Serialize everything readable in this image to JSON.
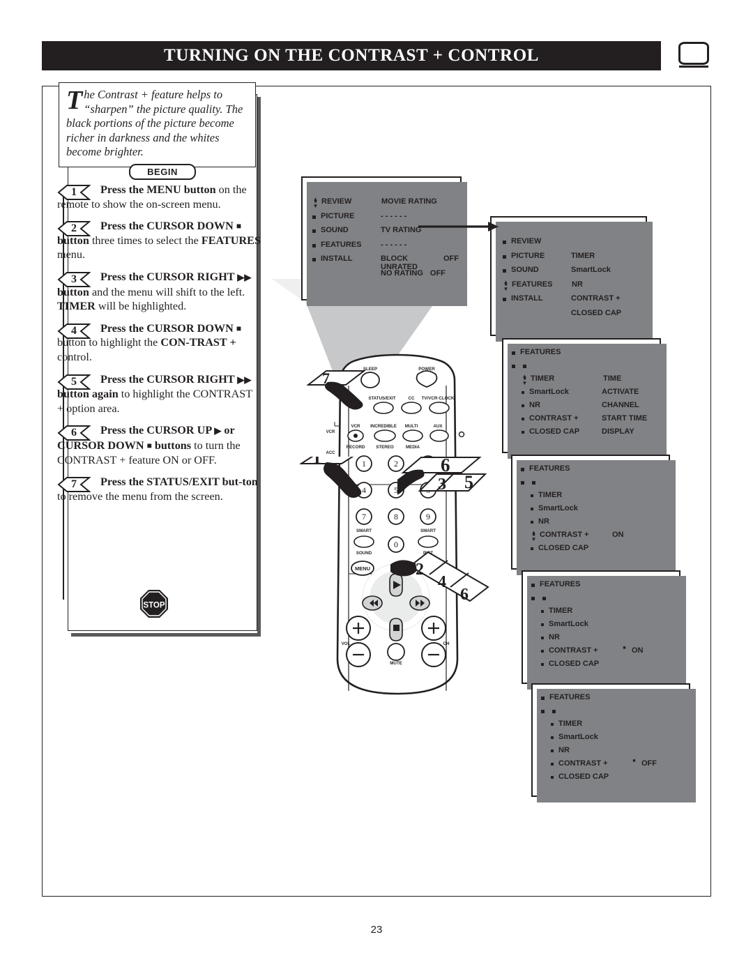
{
  "header": {
    "title": "TURNING ON THE CONTRAST + CONTROL",
    "tv_icon": "tv-screen-icon"
  },
  "intro": {
    "dropcap": "T",
    "text": "he Contrast + feature helps to “sharpen” the picture quality. The black portions of the picture become richer in darkness and the whites become brighter."
  },
  "begin_label": "BEGIN",
  "stop_label": "STOP",
  "steps": [
    {
      "num": "1",
      "html": "<b>Press the MENU button</b> on the remote to show the on-screen menu."
    },
    {
      "num": "2",
      "html": "<b>Press the CURSOR DOWN <span class=\"sq\">■</span> button</b> three times to select the <b>FEATURES</b> menu."
    },
    {
      "num": "3",
      "html": "<b>Press the CURSOR RIGHT <span class=\"tri\">▶▶</span> button</b> and the menu will shift to the left. <b>TIMER</b> will be highlighted."
    },
    {
      "num": "4",
      "html": "<b>Press the CURSOR DOWN <span class=\"sq\">■</span></b> button to highlight the <b>CON-TRAST +</b> control."
    },
    {
      "num": "5",
      "html": "<b>Press the CURSOR RIGHT <span class=\"tri\">▶▶</span> button again</b> to highlight the CONTRAST + option area."
    },
    {
      "num": "6",
      "html": "<b>Press the CURSOR UP <span class=\"tri\">▶</span> or CURSOR DOWN <span class=\"sq\">■</span> buttons</b> to turn the CONTRAST + feature ON or OFF."
    },
    {
      "num": "7",
      "html": "<b>Press the STATUS/EXIT but-ton</b> to remove the menu from the screen."
    }
  ],
  "menus": [
    {
      "id": "menu-main",
      "left_items": [
        "REVIEW",
        "PICTURE",
        "SOUND",
        "FEATURES",
        "INSTALL"
      ],
      "cursor_on": "REVIEW",
      "right_items": [
        {
          "label": "MOVIE RATING",
          "value": ""
        },
        {
          "label": "- - - - - -",
          "value": ""
        },
        {
          "label": "TV RATING",
          "value": ""
        },
        {
          "label": "- - - - - -",
          "value": ""
        },
        {
          "label": "BLOCK UNRATED",
          "value": "OFF"
        },
        {
          "label": "NO RATING",
          "value": "OFF"
        }
      ]
    },
    {
      "id": "menu-features-selected",
      "left_items": [
        "REVIEW",
        "PICTURE",
        "SOUND",
        "FEATURES",
        "INSTALL"
      ],
      "cursor_on": "FEATURES",
      "right_items": [
        {
          "label": "",
          "value": ""
        },
        {
          "label": "TIMER",
          "value": ""
        },
        {
          "label": "SmartLock",
          "value": ""
        },
        {
          "label": "NR",
          "value": ""
        },
        {
          "label": "CONTRAST +",
          "value": ""
        },
        {
          "label": "CLOSED CAP",
          "value": ""
        }
      ]
    },
    {
      "id": "menu-timer-highlighted",
      "title": "FEATURES",
      "left_items": [
        "TIMER",
        "SmartLock",
        "NR",
        "CONTRAST +",
        "CLOSED CAP"
      ],
      "cursor_on": "TIMER",
      "right_items": [
        {
          "label": "TIME",
          "value": ""
        },
        {
          "label": "ACTIVATE",
          "value": ""
        },
        {
          "label": "CHANNEL",
          "value": ""
        },
        {
          "label": "START TIME",
          "value": ""
        },
        {
          "label": "DISPLAY",
          "value": ""
        }
      ]
    },
    {
      "id": "menu-contrast-highlighted",
      "title": "FEATURES",
      "left_items": [
        "TIMER",
        "SmartLock",
        "NR",
        "CONTRAST +",
        "CLOSED CAP"
      ],
      "cursor_on": "CONTRAST +",
      "value_label": "ON",
      "value_row": 3
    },
    {
      "id": "menu-contrast-option-on",
      "title": "FEATURES",
      "left_items": [
        "TIMER",
        "SmartLock",
        "NR",
        "CONTRAST +",
        "CLOSED CAP"
      ],
      "cursor_on": "",
      "value_label": "ON",
      "value_cursor": true,
      "value_row": 3
    },
    {
      "id": "menu-contrast-option-off",
      "title": "FEATURES",
      "left_items": [
        "TIMER",
        "SmartLock",
        "NR",
        "CONTRAST +",
        "CLOSED CAP"
      ],
      "cursor_on": "",
      "value_label": "OFF",
      "value_cursor": true,
      "value_row": 3
    }
  ],
  "remote": {
    "top_labels": [
      "SLEEP",
      "POWER"
    ],
    "row_labels": [
      "STATUS/EXIT",
      "CC",
      "TV/VCR·CLOCK"
    ],
    "mode_labels": [
      "VCR",
      "INCREDIBLE",
      "MULTI",
      "AUX"
    ],
    "sub_labels": [
      "RECORD",
      "STEREO",
      "MEDIA"
    ],
    "side_labels": [
      "VCR",
      "ACC"
    ],
    "keypad": [
      "1",
      "2",
      "3",
      "4",
      "5",
      "6",
      "7",
      "8",
      "9",
      "0"
    ],
    "smart_left": "SMART",
    "smart_left_sub": "SOUND",
    "smart_right": "SMART",
    "smart_right_sub": "PICT",
    "menu_button": "MENU",
    "vol_label": "VOL",
    "ch_label": "CH",
    "mute_label": "MUTE"
  },
  "callouts": [
    {
      "num": "7",
      "target": "status-exit-button"
    },
    {
      "num": "1",
      "target": "menu-button"
    },
    {
      "num": "6",
      "target": "cursor-up-button"
    },
    {
      "num": "3",
      "target": "cursor-right-button"
    },
    {
      "num": "5",
      "target": "cursor-right-button"
    },
    {
      "num": "2",
      "target": "cursor-down-button"
    },
    {
      "num": "4",
      "target": "cursor-down-button"
    },
    {
      "num": "6",
      "target": "cursor-down-button"
    }
  ],
  "page_number": "23"
}
